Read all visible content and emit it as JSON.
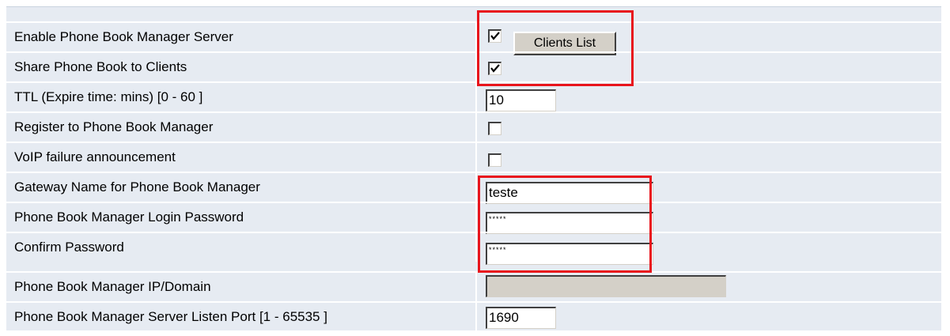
{
  "rows": [
    {
      "label": "Enable Phone Book Manager Server"
    },
    {
      "label": "Share Phone Book to Clients"
    },
    {
      "label": "TTL (Expire time: mins) [0 - 60 ]"
    },
    {
      "label": "Register to Phone Book Manager"
    },
    {
      "label": "VoIP failure announcement"
    },
    {
      "label": "Gateway Name for Phone Book Manager"
    },
    {
      "label": "Phone Book Manager Login Password"
    },
    {
      "label": "Confirm Password"
    },
    {
      "label": "Phone Book Manager IP/Domain"
    },
    {
      "label": "Phone Book Manager Server Listen Port [1 - 65535 ]"
    }
  ],
  "fields": {
    "enable_server": true,
    "share_phone_book": true,
    "ttl": "10",
    "register": false,
    "voip_failure": false,
    "gateway_name": "teste",
    "login_password": "*****",
    "confirm_password": "*****",
    "ip_domain": "",
    "listen_port": "1690"
  },
  "buttons": {
    "clients_list": "Clients List"
  },
  "colors": {
    "panel": "#e6ebf2",
    "highlight": "#e8141c"
  }
}
